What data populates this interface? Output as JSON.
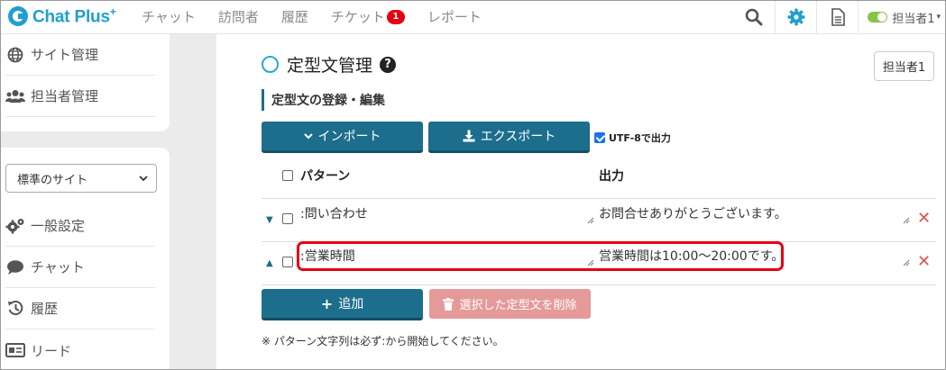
{
  "app": {
    "logo_text": "Chat Plus",
    "logo_sup": "+"
  },
  "nav": {
    "items": [
      "チャット",
      "訪問者",
      "履歴",
      "チケット",
      "レポート"
    ],
    "ticket_badge": "1"
  },
  "header": {
    "user_label": "担当者1"
  },
  "sidebar": {
    "top_items": [
      {
        "label": "サイト管理",
        "icon": "globe-icon"
      },
      {
        "label": "担当者管理",
        "icon": "users-icon"
      }
    ],
    "site_select": "標準のサイト",
    "items": [
      {
        "label": "一般設定",
        "icon": "cogs-icon"
      },
      {
        "label": "チャット",
        "icon": "comment-icon"
      },
      {
        "label": "履歴",
        "icon": "history-icon"
      },
      {
        "label": "リード",
        "icon": "id-card-icon"
      }
    ]
  },
  "main": {
    "page_title": "定型文管理",
    "agent_button": "担当者1",
    "section_title": "定型文の登録・編集",
    "import_label": "インポート",
    "export_label": "エクスポート",
    "utf8_label": "UTF-8で出力",
    "col_pattern": "パターン",
    "col_output": "出力",
    "rows": [
      {
        "pattern": ":問い合わせ",
        "output": "お問合せありがとうございます。"
      },
      {
        "pattern": ":営業時間",
        "output": "営業時間は10:00～20:00です。"
      }
    ],
    "add_label": "追加",
    "delete_label": "選択した定型文を削除",
    "note": "※ パターン文字列は必ず:から開始してください。"
  },
  "colors": {
    "accent": "#1c6e8c",
    "brand": "#1f9fcf",
    "highlight": "#e60012",
    "danger": "#d9534f"
  }
}
